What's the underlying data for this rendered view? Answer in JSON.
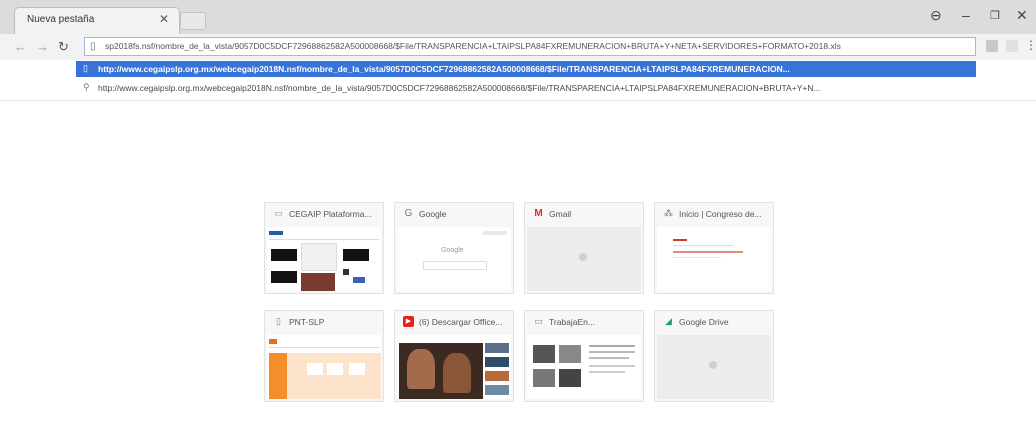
{
  "browser": {
    "tab_title": "Nueva pestaña",
    "tab_close": "✕",
    "address_value": "sp2018fs.nsf/nombre_de_la_vista/9057D0C5DCF72968862582A500008668/$File/TRANSPARENCIA+LTAIPSLPA84FXREMUNERACION+BRUTA+Y+NETA+SERVIDORES+FORMATO+2018.xls",
    "suggestion_url": "http://www.cegaipslp.org.mx/webcegaip2018N.nsf/nombre_de_la_vista/9057D0C5DCF72968862582A500008668/$File/TRANSPARENCIA+LTAIPSLPA84FXREMUNERACION...",
    "suggestion_search": "http://www.cegaipslp.org.mx/webcegaip2018N.nsf/nombre_de_la_vista/9057D0C5DCF72968862582A500008668/$File/TRANSPARENCIA+LTAIPSLPA84FXREMUNERACION+BRUTA+Y+N..."
  },
  "tiles": [
    {
      "title": "CEGAIP Plataforma...",
      "icon": "page-icon"
    },
    {
      "title": "Google",
      "icon": "google-icon"
    },
    {
      "title": "Gmail",
      "icon": "gmail-icon"
    },
    {
      "title": "Inicio | Congreso de...",
      "icon": "congress-icon"
    },
    {
      "title": "PNT-SLP",
      "icon": "page-icon"
    },
    {
      "title": "(6) Descargar Office...",
      "icon": "youtube-icon"
    },
    {
      "title": "TrabajaEn...",
      "icon": "page-icon"
    },
    {
      "title": "Google Drive",
      "icon": "drive-icon"
    }
  ],
  "thumb_google_text": "Google",
  "colors": {
    "accent": "#3874d8",
    "gmail": "#d93025",
    "youtube": "#e62117"
  }
}
